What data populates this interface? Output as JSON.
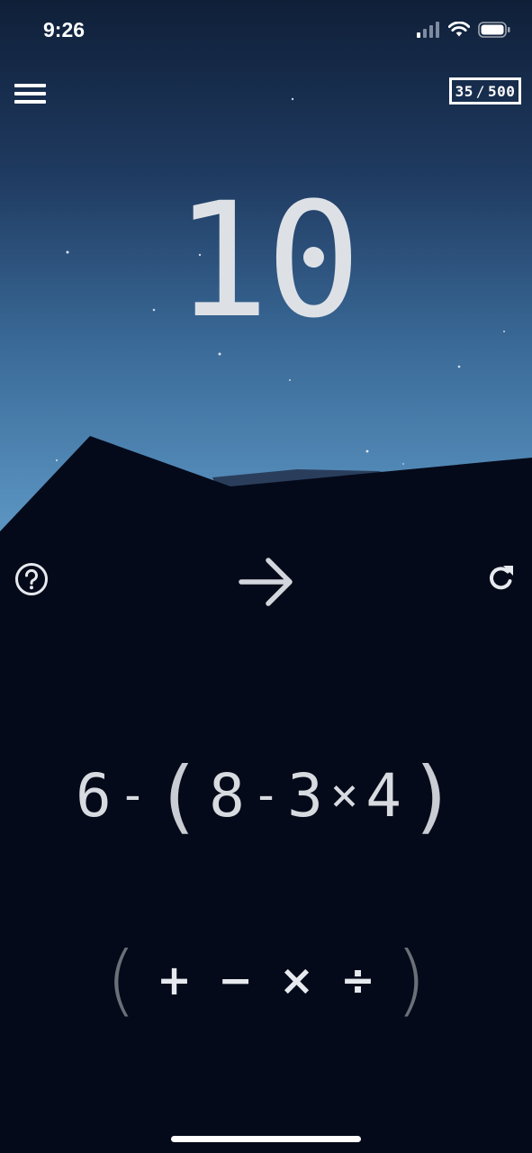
{
  "status_bar": {
    "time": "9:26"
  },
  "header": {
    "score_current": "35",
    "score_separator": "/",
    "score_total": "500"
  },
  "target": {
    "value": "10"
  },
  "controls": {
    "help_icon": "question-circle-icon",
    "next_icon": "arrow-right-icon",
    "reset_icon": "refresh-icon"
  },
  "expression": {
    "tokens": [
      "6",
      "-",
      "(",
      "8",
      "-",
      "3",
      "×",
      "4",
      ")"
    ]
  },
  "operators": {
    "open_paren": "(",
    "plus": "+",
    "minus": "−",
    "times": "×",
    "divide": "÷",
    "close_paren": ")"
  },
  "colors": {
    "sky_top": "#0f1f38",
    "sky_bottom": "#5a93c0",
    "ground": "#050a1a",
    "text": "#d9dde3"
  }
}
